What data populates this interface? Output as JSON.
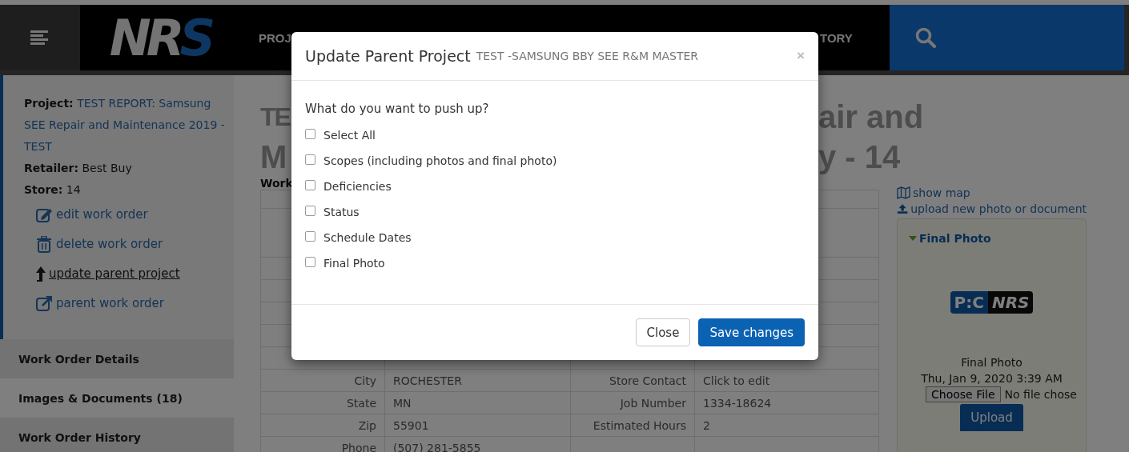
{
  "header": {
    "logo": "NRS",
    "nav": [
      {
        "label": "PROJ"
      },
      {
        "label": "TORY"
      }
    ]
  },
  "sidebar": {
    "info": [
      {
        "label": "Project:",
        "value": "TEST REPORT: Samsung SEE Repair and Maintenance 2019 - TEST",
        "kind": "link"
      },
      {
        "label": "Retailer:",
        "value": "Best Buy",
        "kind": "plain"
      },
      {
        "label": "Store:",
        "value": "14",
        "kind": "plain"
      }
    ],
    "actions": [
      {
        "label": "edit work order",
        "hovered": false
      },
      {
        "label": "delete work order",
        "hovered": false
      },
      {
        "label": "update parent project",
        "hovered": true
      },
      {
        "label": "parent work order",
        "hovered": false
      }
    ],
    "tabs": [
      {
        "label": "Work Order Details",
        "selected": false
      },
      {
        "label": "Images & Documents (18)",
        "selected": true
      },
      {
        "label": "Work Order History",
        "selected": false
      }
    ]
  },
  "main": {
    "title_fragments": [
      "TE",
      "air and",
      "M",
      "y - 14"
    ],
    "section_label": "Work",
    "table": {
      "rows": [
        [
          "City",
          "ROCHESTER",
          "Store Contact",
          "Click to edit"
        ],
        [
          "State",
          "MN",
          "Job Number",
          "1334-18624"
        ],
        [
          "Zip",
          "55901",
          "Estimated Hours",
          "2"
        ],
        [
          "Phone",
          "(507) 281-5855"
        ]
      ]
    }
  },
  "side_panel": {
    "links": [
      "show map",
      "upload new photo or document"
    ],
    "card": {
      "title": "Final Photo",
      "expanded": true,
      "logo": [
        "P:C",
        "NRS"
      ],
      "caption": "Final Photo",
      "date": "Thu, Jan 9, 2020 3:39 AM",
      "file_button": "Choose File",
      "file_status": "No file chose",
      "upload": "Upload"
    }
  },
  "modal": {
    "title": "Update Parent Project",
    "subtitle": "TEST -SAMSUNG BBY SEE R&M MASTER",
    "close": "×",
    "question": "What do you want to push up?",
    "options": [
      {
        "label": "Select All",
        "checked": false
      },
      {
        "label": "Scopes (including photos and final photo)",
        "checked": false
      },
      {
        "label": "Deficiencies",
        "checked": false
      },
      {
        "label": "Status",
        "checked": false
      },
      {
        "label": "Schedule Dates",
        "checked": false
      },
      {
        "label": "Final Photo",
        "checked": false
      }
    ],
    "buttons": [
      {
        "label": "Close",
        "kind": "default"
      },
      {
        "label": "Save changes",
        "kind": "primary"
      }
    ]
  }
}
